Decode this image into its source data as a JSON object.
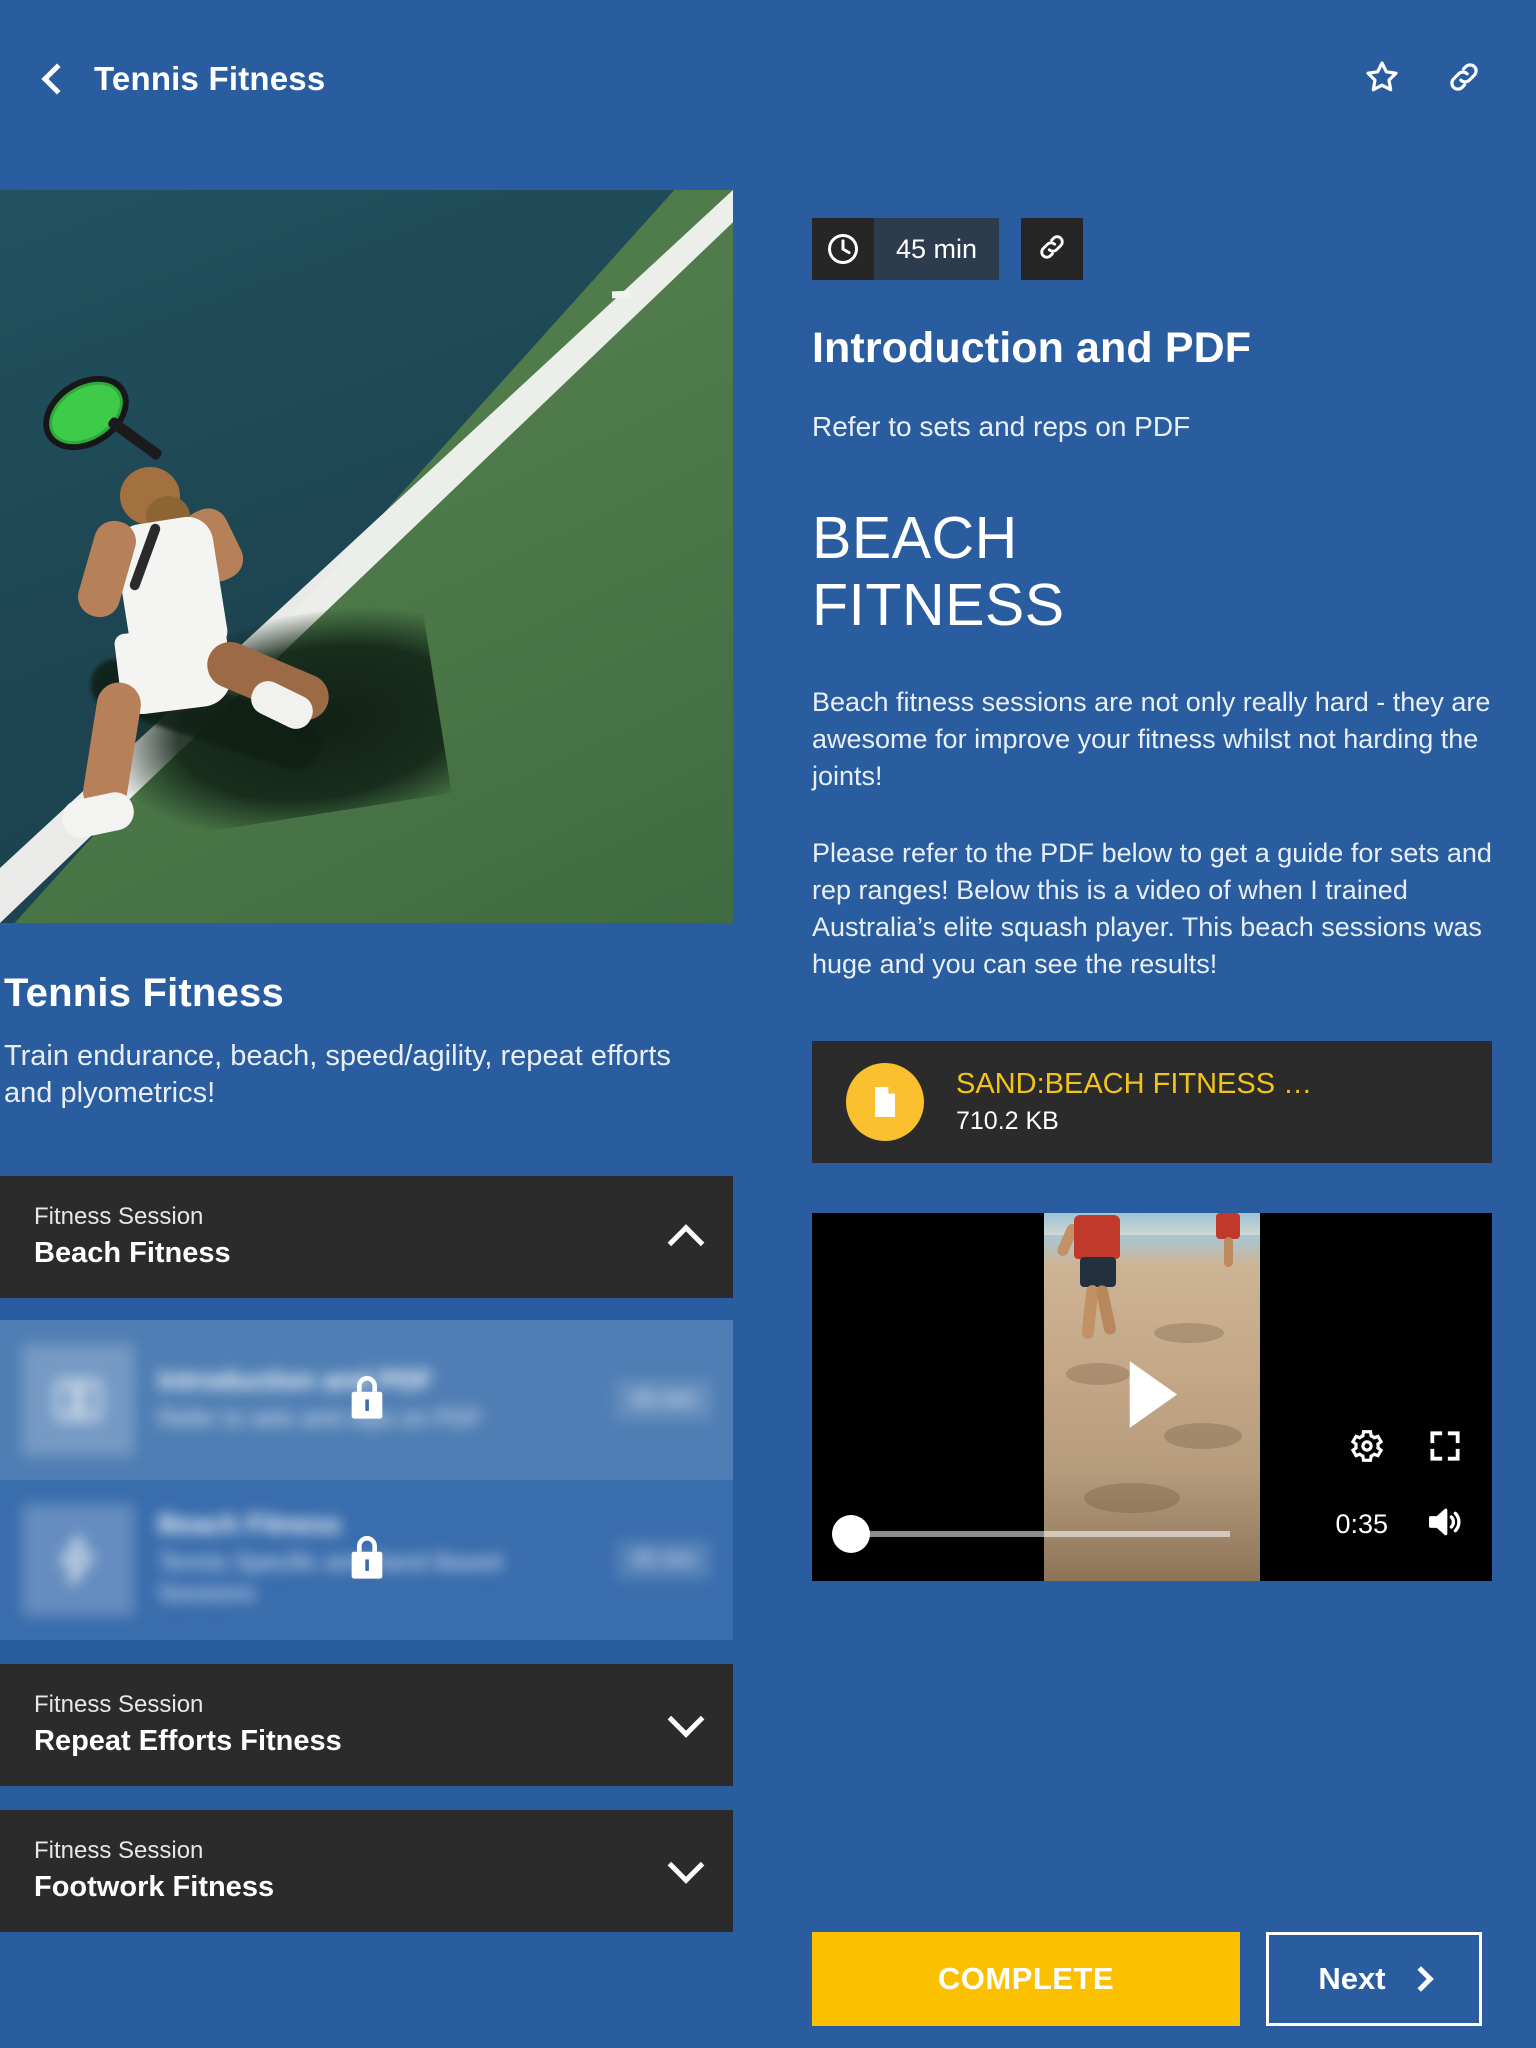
{
  "topbar": {
    "back_icon": "chevron-left-icon",
    "title": "Tennis Fitness",
    "favorite_icon": "star-icon",
    "share_icon": "link-icon"
  },
  "course": {
    "hero_alt": "tennis-player-on-court",
    "title": "Tennis Fitness",
    "description": "Train endurance, beach, speed/agility, repeat efforts and plyometrics!"
  },
  "accordion": [
    {
      "kicker": "Fitness Session",
      "title": "Beach Fitness",
      "expanded": true,
      "chevron": "chevron-up-icon",
      "lessons": [
        {
          "name": "Introduction and PDF",
          "desc": "Refer to sets and reps on PDF",
          "duration": "45 min",
          "locked": true,
          "lock_icon": "lock-icon",
          "thumb_icon": "book-icon",
          "state": "active"
        },
        {
          "name": "Beach Fitness",
          "desc": "Tennis Specific and Sand Based Sessions",
          "duration": "45 min",
          "locked": true,
          "lock_icon": "lock-icon",
          "thumb_icon": "bolt-icon",
          "state": "next"
        }
      ]
    },
    {
      "kicker": "Fitness Session",
      "title": "Repeat Efforts Fitness",
      "expanded": false,
      "chevron": "chevron-down-icon",
      "lessons": []
    },
    {
      "kicker": "Fitness Session",
      "title": "Footwork Fitness",
      "expanded": false,
      "chevron": "chevron-down-icon",
      "lessons": []
    }
  ],
  "lesson": {
    "duration_badge": "45 min",
    "clock_icon": "clock-icon",
    "share_icon": "link-icon",
    "title": "Introduction and PDF",
    "subtitle": "Refer to sets and reps on PDF",
    "heading_line1": "BEACH",
    "heading_line2": "FITNESS",
    "paragraph1": "Beach fitness sessions are not only really hard - they are awesome for improve your fitness whilst not harding the joints!",
    "paragraph2": "Please refer to the PDF below to get a guide for sets and rep ranges! Below this is a video of when I trained Australia’s elite squash player. This beach sessions was huge and you can see the results!"
  },
  "attachment": {
    "icon": "document-icon",
    "name": "SAND:BEACH FITNESS …",
    "size": "710.2 KB"
  },
  "video": {
    "play_icon": "play-icon",
    "settings_icon": "gear-icon",
    "fullscreen_icon": "fullscreen-icon",
    "volume_icon": "volume-icon",
    "time": "0:35",
    "poster_alt": "beach-sprint-training"
  },
  "footer": {
    "complete_label": "COMPLETE",
    "next_label": "Next",
    "next_icon": "chevron-right-icon"
  },
  "colors": {
    "background": "#2A5DA0",
    "card_dark": "#2B2B2B",
    "accent_yellow": "#FBC100",
    "pdf_text_yellow": "#F2C318",
    "active_lesson": "#4F7EB4",
    "next_lesson": "#3A6DAD"
  }
}
